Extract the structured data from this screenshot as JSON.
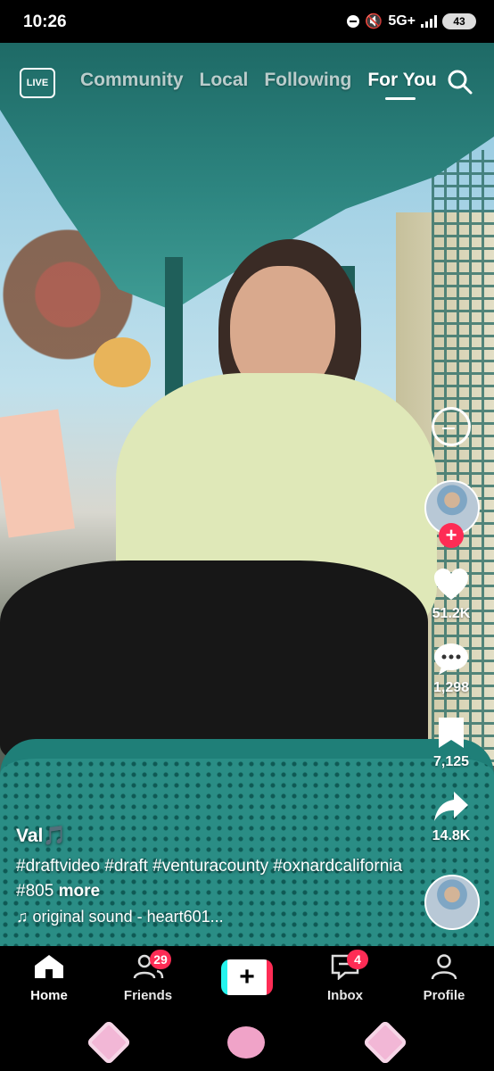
{
  "status_bar": {
    "time": "10:26",
    "network": "5G+",
    "battery": "43"
  },
  "top_nav": {
    "live_label": "LIVE",
    "tabs": [
      {
        "label": "Community"
      },
      {
        "label": "Local"
      },
      {
        "label": "Following"
      },
      {
        "label": "For You",
        "active": true
      }
    ]
  },
  "right_rail": {
    "like_count": "51.2K",
    "comment_count": "1,298",
    "save_count": "7,125",
    "share_count": "14.8K"
  },
  "caption": {
    "username": "Val🎵",
    "description": "#draftvideo #draft #venturacounty #oxnardcalifornia #805",
    "more_label": "more",
    "sound": "original sound - heart601..."
  },
  "bottom_nav": {
    "items": [
      {
        "label": "Home",
        "active": true
      },
      {
        "label": "Friends",
        "badge": "29"
      },
      {
        "label": "Inbox",
        "badge": "4"
      },
      {
        "label": "Profile"
      }
    ]
  },
  "colors": {
    "accent": "#fe2c55",
    "cyan": "#25f4ee",
    "background": "#000000"
  },
  "icons": [
    "live-icon",
    "search-icon",
    "effect-icon",
    "heart-icon",
    "comment-icon",
    "bookmark-icon",
    "share-icon",
    "music-note-icon",
    "home-icon",
    "friends-icon",
    "create-icon",
    "inbox-icon",
    "profile-icon"
  ]
}
